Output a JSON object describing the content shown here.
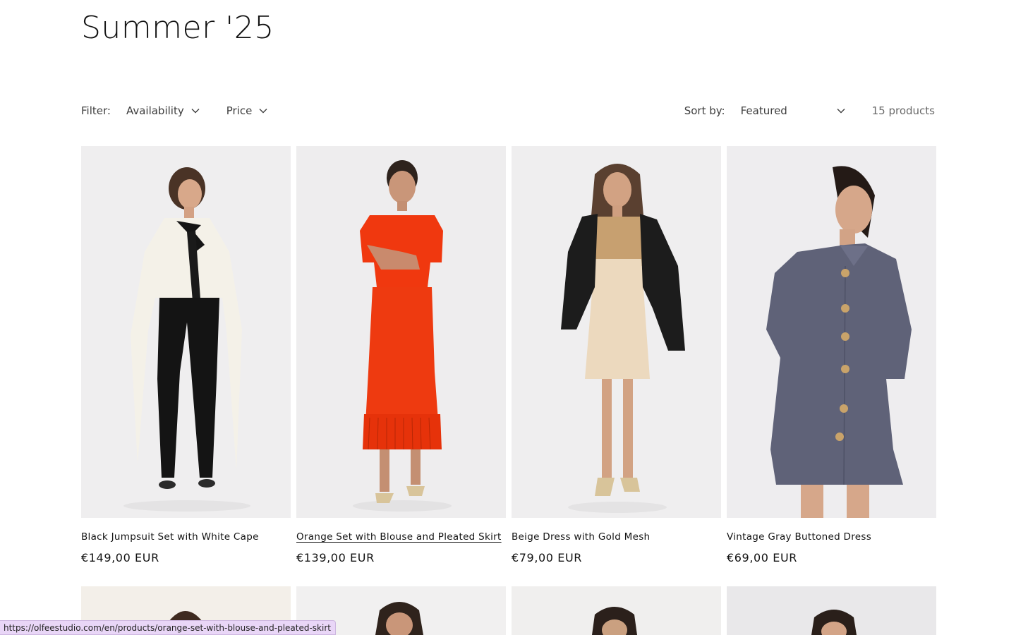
{
  "collection": {
    "title": "Summer '25"
  },
  "filters": {
    "label": "Filter:",
    "availability": "Availability",
    "price": "Price"
  },
  "sort": {
    "label": "Sort by:",
    "selected": "Featured",
    "count": "15 products"
  },
  "products": [
    {
      "title": "Black Jumpsuit Set with White Cape",
      "price": "€149,00 EUR"
    },
    {
      "title": "Orange Set with Blouse and Pleated Skirt",
      "price": "€139,00 EUR"
    },
    {
      "title": "Beige Dress with Gold Mesh",
      "price": "€79,00 EUR"
    },
    {
      "title": "Vintage Gray Buttoned Dress",
      "price": "€69,00 EUR"
    }
  ],
  "status_bar": {
    "url": "https://olfeestudio.com/en/products/orange-set-with-blouse-and-pleated-skirt"
  },
  "colors": {
    "text": "#121212",
    "muted": "#6a6a6a",
    "photo_bg": "#efeeef",
    "status_bg": "#e9d6f7"
  }
}
